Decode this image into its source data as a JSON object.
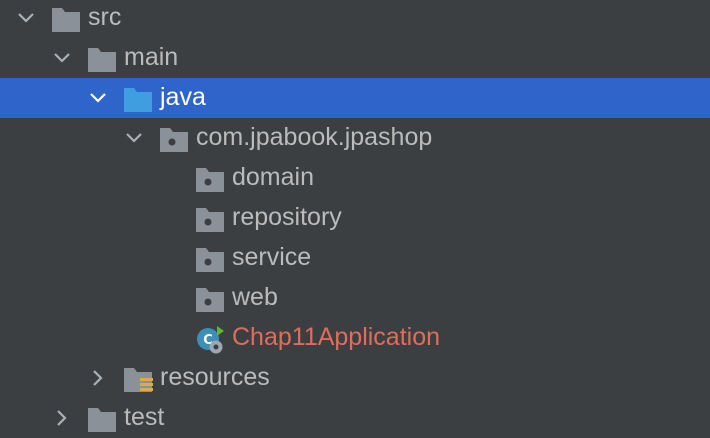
{
  "colors": {
    "background": "#3c3f41",
    "selection": "#2f65ca",
    "text": "#bbbbbb",
    "selected_text": "#ffffff",
    "folder_gray": "#8a9199",
    "folder_blue": "#3f9ee0",
    "spring_app_text": "#e06c5a"
  },
  "tree": {
    "src": {
      "label": "src",
      "expanded": true,
      "icon": "folder-icon"
    },
    "main": {
      "label": "main",
      "expanded": true,
      "icon": "folder-icon"
    },
    "java": {
      "label": "java",
      "expanded": true,
      "selected": true,
      "icon": "source-root-folder-icon"
    },
    "package": {
      "label": "com.jpabook.jpashop",
      "expanded": true,
      "icon": "package-icon"
    },
    "domain": {
      "label": "domain",
      "icon": "package-icon"
    },
    "repository": {
      "label": "repository",
      "icon": "package-icon"
    },
    "service": {
      "label": "service",
      "icon": "package-icon"
    },
    "web": {
      "label": "web",
      "icon": "package-icon"
    },
    "app": {
      "label": "Chap11Application",
      "icon": "spring-boot-app-icon"
    },
    "resources": {
      "label": "resources",
      "expanded": false,
      "icon": "resources-folder-icon"
    },
    "test": {
      "label": "test",
      "expanded": false,
      "icon": "folder-icon"
    }
  }
}
